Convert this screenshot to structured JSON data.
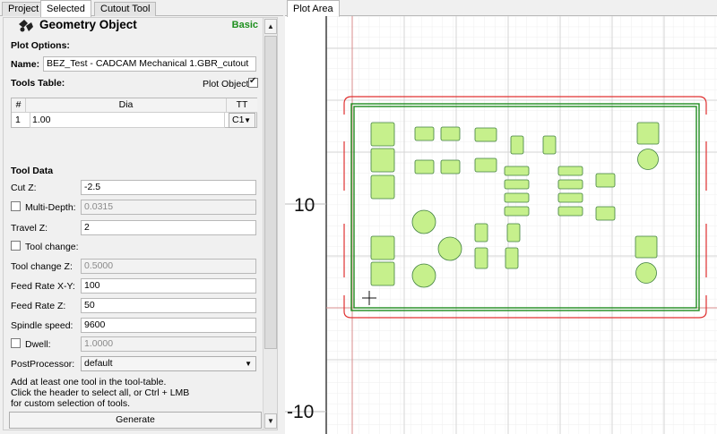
{
  "left_tabs": [
    "Project",
    "Selected",
    "Cutout Tool"
  ],
  "active_left_tab": "Selected",
  "header": {
    "title": "Geometry Object",
    "mode": "Basic",
    "icon": "geometry-icon"
  },
  "plot_options": {
    "heading": "Plot Options:",
    "name_label": "Name:",
    "name_value": "BEZ_Test - CADCAM Mechanical 1.GBR_cutout",
    "tools_table_heading": "Tools Table:",
    "plot_object_label": "Plot Object",
    "plot_object_checked": true
  },
  "tools_table": {
    "columns": [
      "#",
      "Dia",
      "TT"
    ],
    "rows": [
      {
        "num": "1",
        "dia": "1.00",
        "tt": "C1"
      }
    ]
  },
  "tool_data": {
    "heading": "Tool Data",
    "cut_z_label": "Cut Z:",
    "cut_z": "-2.5",
    "multi_depth_label": "Multi-Depth:",
    "multi_depth": "0.0315",
    "multi_depth_checked": false,
    "travel_z_label": "Travel Z:",
    "travel_z": "2",
    "tool_change_label": "Tool change:",
    "tool_change_checked": false,
    "tool_change_z_label": "Tool change Z:",
    "tool_change_z": "0.5000",
    "feed_xy_label": "Feed Rate X-Y:",
    "feed_xy": "100",
    "feed_z_label": "Feed Rate Z:",
    "feed_z": "50",
    "spindle_label": "Spindle speed:",
    "spindle": "9600",
    "dwell_label": "Dwell:",
    "dwell": "1.0000",
    "dwell_checked": false,
    "postprocessor_label": "PostProcessor:",
    "postprocessor": "default"
  },
  "hint": {
    "line1": "Add at least one tool in the tool-table.",
    "line2": "Click the header to select all, or Ctrl + LMB",
    "line3": "for custom selection of tools."
  },
  "generate_label": "Generate",
  "plot_tab": "Plot Area",
  "plot": {
    "y_tick_labels": [
      "10",
      "-10"
    ],
    "colors": {
      "pad_fill": "#c6f08c",
      "pad_stroke": "#3f7f3f",
      "board_outline": "#1e8c1e",
      "cutout_path": "#e03030",
      "grid": "#e2e2e2",
      "axis": "#d88c8c"
    }
  }
}
